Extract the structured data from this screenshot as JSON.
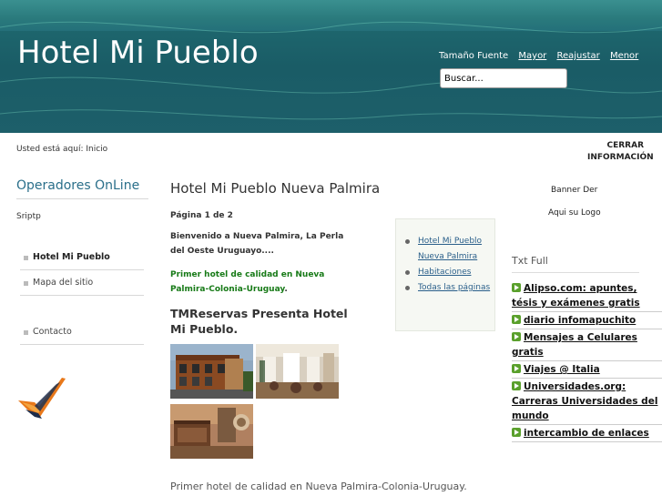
{
  "header": {
    "site_title": "Hotel Mi Pueblo",
    "font_label": "Tamaño Fuente",
    "font_bigger": "Mayor",
    "font_reset": "Reajustar",
    "font_smaller": "Menor",
    "search_value": "Buscar..."
  },
  "breadcrumb": "Usted está aquí: Inicio",
  "close_info": "CERRAR INFORMACIÓN",
  "left": {
    "operadores_title": "Operadores OnLine",
    "script_text": "Sriptp",
    "menu": [
      {
        "label": "Hotel Mi Pueblo",
        "active": true
      },
      {
        "label": "Mapa del sitio",
        "active": false
      }
    ],
    "menu2": [
      {
        "label": "Contacto"
      }
    ]
  },
  "main": {
    "title": "Hotel Mi Pueblo Nueva Palmira",
    "page_of": "Página 1 de 2",
    "intro": "Bienvenido a Nueva Palmira, La Perla del Oeste Uruguayo....",
    "highlight": "Primer hotel de calidad en Nueva Palmira-Colonia-Uruguay",
    "highlight_end": ".",
    "sub_heading": "TMReservas Presenta Hotel Mi Pueblo.",
    "caption": "Primer hotel de calidad en Nueva Palmira-Colonia-Uruguay."
  },
  "toc": {
    "items": [
      "Hotel Mi Pueblo Nueva Palmira",
      "Habitaciones",
      "Todas las páginas"
    ]
  },
  "right": {
    "banner": "Banner Der",
    "logo_text": "Aqui su Logo",
    "txt_full_title": "Txt Full",
    "links": [
      "Alipso.com: apuntes, tésis y exámenes gratis",
      "diario infomapuchito",
      "Mensajes a Celulares gratis",
      "Viajes @ Italia",
      "Universidades.org: Carreras Universidades del mundo",
      "intercambio de enlaces"
    ]
  },
  "colors": {
    "header_teal": "#1d5f6a",
    "title_blue": "#2a6f8a",
    "highlight_green": "#177a17",
    "icon_green": "#5aa02c",
    "check_orange": "#e8781a"
  }
}
